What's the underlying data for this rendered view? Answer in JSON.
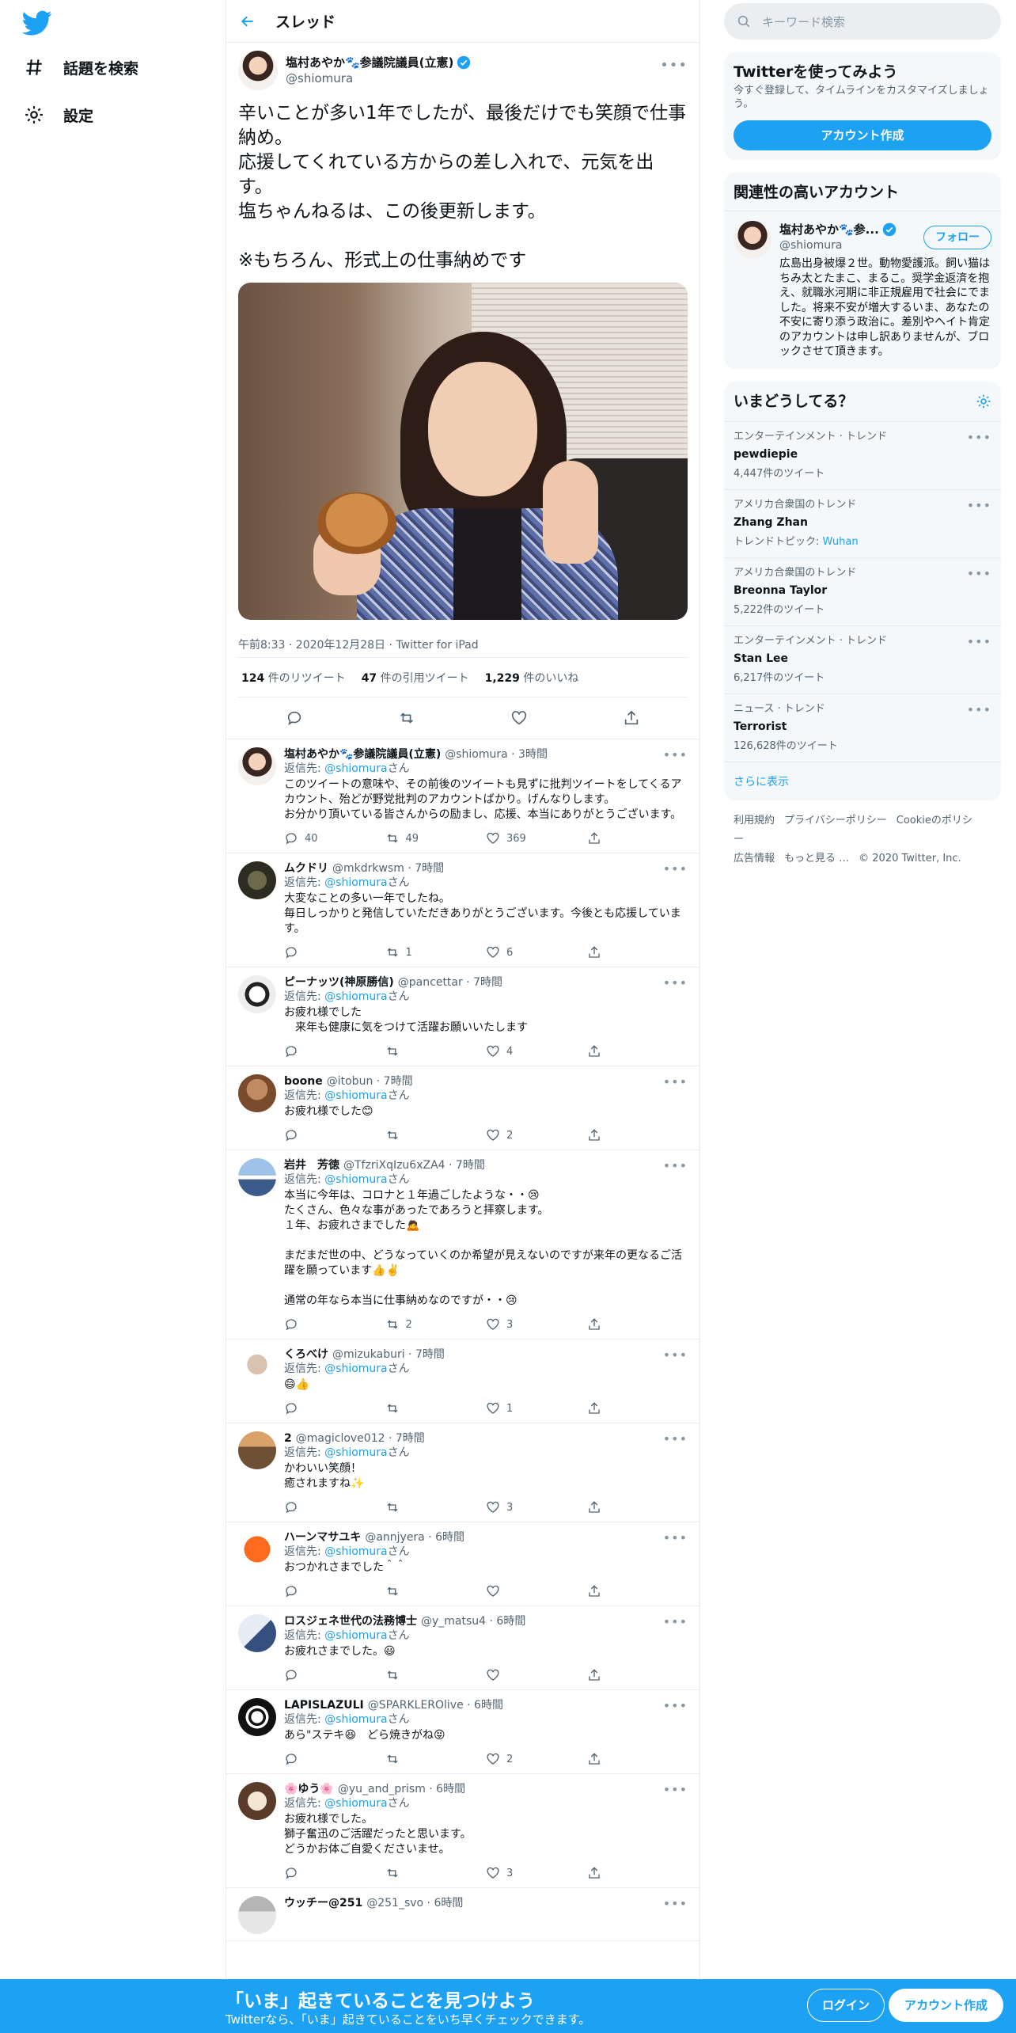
{
  "nav": {
    "explore": "話題を検索",
    "settings": "設定"
  },
  "header": {
    "title": "スレッド"
  },
  "main_tweet": {
    "name": "塩村あやか🐾参議院議員(立憲)",
    "handle": "@shiomura",
    "text": "辛いことが多い1年でしたが、最後だけでも笑顔で仕事納め。\n応援してくれている方からの差し入れで、元気を出す。\n塩ちゃんねるは、この後更新します。\n\n※もちろん、形式上の仕事納めです",
    "meta": "午前8:33 · 2020年12月28日 · Twitter for iPad",
    "retweets_num": "124",
    "retweets_label": "件のリツイート",
    "quotes_num": "47",
    "quotes_label": "件の引用ツイート",
    "likes_num": "1,229",
    "likes_label": "件のいいね"
  },
  "replies": [
    {
      "name": "塩村あやか🐾参議院議員(立憲)",
      "handle": "@shiomura · 3時間",
      "reply_to_prefix": "返信先: ",
      "reply_to": "@shiomura",
      "reply_to_suffix": "さん",
      "text": "このツイートの意味や、その前後のツイートも見ずに批判ツイートをしてくるアカウント、殆どが野党批判のアカウントばかり。げんなりします。\nお分かり頂いている皆さんからの励まし、応援、本当にありがとうございます。",
      "replies": "40",
      "retweets": "49",
      "likes": "369"
    },
    {
      "name": "ムクドリ",
      "handle": "@mkdrkwsm · 7時間",
      "reply_to_prefix": "返信先: ",
      "reply_to": "@shiomura",
      "reply_to_suffix": "さん",
      "text": "大変なことの多い一年でしたね。\n毎日しっかりと発信していただきありがとうございます。今後とも応援しています。",
      "replies": "",
      "retweets": "1",
      "likes": "6"
    },
    {
      "name": "ピーナッツ(神原勝信)",
      "handle": "@pancettar · 7時間",
      "reply_to_prefix": "返信先: ",
      "reply_to": "@shiomura",
      "reply_to_suffix": "さん",
      "text": "お疲れ様でした\n　来年も健康に気をつけて活躍お願いいたします",
      "replies": "",
      "retweets": "",
      "likes": "4"
    },
    {
      "name": "boone",
      "handle": "@itobun · 7時間",
      "reply_to_prefix": "返信先: ",
      "reply_to": "@shiomura",
      "reply_to_suffix": "さん",
      "text": "お疲れ様でした😊",
      "replies": "",
      "retweets": "",
      "likes": "2"
    },
    {
      "name": "岩井　芳徳",
      "handle": "@TfzriXqIzu6xZA4 · 7時間",
      "reply_to_prefix": "返信先: ",
      "reply_to": "@shiomura",
      "reply_to_suffix": "さん",
      "text": "本当に今年は、コロナと１年過ごしたような・・😢\nたくさん、色々な事があったであろうと拝察します。\n１年、お疲れさまでした🙇\n\nまだまだ世の中、どうなっていくのか希望が見えないのですが来年の更なるご活躍を願っています👍✌️\n\n通常の年なら本当に仕事納めなのですが・・😢",
      "replies": "",
      "retweets": "2",
      "likes": "3"
    },
    {
      "name": "くろべけ",
      "handle": "@mizukaburi · 7時間",
      "reply_to_prefix": "返信先: ",
      "reply_to": "@shiomura",
      "reply_to_suffix": "さん",
      "text": "😄👍",
      "replies": "",
      "retweets": "",
      "likes": "1"
    },
    {
      "name": "2",
      "handle": "@magiclove012 · 7時間",
      "reply_to_prefix": "返信先: ",
      "reply_to": "@shiomura",
      "reply_to_suffix": "さん",
      "text": "かわいい笑顔！\n癒されますね✨",
      "replies": "",
      "retweets": "",
      "likes": "3"
    },
    {
      "name": "ハーンマサユキ",
      "handle": "@annjyera · 6時間",
      "reply_to_prefix": "返信先: ",
      "reply_to": "@shiomura",
      "reply_to_suffix": "さん",
      "text": "おつかれさまでした＾＾",
      "replies": "",
      "retweets": "",
      "likes": ""
    },
    {
      "name": "ロスジェネ世代の法務博士",
      "handle": "@y_matsu4 · 6時間",
      "reply_to_prefix": "返信先: ",
      "reply_to": "@shiomura",
      "reply_to_suffix": "さん",
      "text": "お疲れさまでした。😃",
      "replies": "",
      "retweets": "",
      "likes": ""
    },
    {
      "name": "LAPISLAZULI",
      "handle": "@SPARKLEROlive · 6時間",
      "reply_to_prefix": "返信先: ",
      "reply_to": "@shiomura",
      "reply_to_suffix": "さん",
      "text": "あら\"ステキ😆　どら焼きがね😝",
      "replies": "",
      "retweets": "",
      "likes": "2"
    },
    {
      "name": "🌸ゆう🌸",
      "handle": "@yu_and_prism · 6時間",
      "reply_to_prefix": "返信先: ",
      "reply_to": "@shiomura",
      "reply_to_suffix": "さん",
      "text": "お疲れ様でした。\n獅子奮迅のご活躍だったと思います。\nどうかお体ご自愛くださいませ。",
      "replies": "",
      "retweets": "",
      "likes": "3"
    },
    {
      "name": "ウッチー@251",
      "handle": "@251_svo · 6時間",
      "reply_to_prefix": "",
      "reply_to": "",
      "reply_to_suffix": "",
      "text": "",
      "replies": "",
      "retweets": "",
      "likes": ""
    }
  ],
  "sidebar": {
    "search_placeholder": "キーワード検索",
    "signup_box": {
      "title": "Twitterを使ってみよう",
      "sub": "今すぐ登録して、タイムラインをカスタマイズしましょう。",
      "button": "アカウント作成"
    },
    "related": {
      "title": "関連性の高いアカウント",
      "name": "塩村あやか🐾参...",
      "handle": "@shiomura",
      "follow": "フォロー",
      "desc": "広島出身被爆２世。動物愛護派。飼い猫はちみ太とたまこ、まるこ。奨学金返済を抱え、就職氷河期に非正規雇用で社会にでました。将来不安が増大するいま、あなたの不安に寄り添う政治に。差別やヘイト肯定のアカウントは申し訳ありませんが、ブロックさせて頂きます。"
    },
    "trends": {
      "title": "いまどうしてる？",
      "items": [
        {
          "cat": "エンターテインメント · トレンド",
          "name": "pewdiepie",
          "count": "4,447件のツイート",
          "topic": ""
        },
        {
          "cat": "アメリカ合衆国のトレンド",
          "name": "Zhang Zhan",
          "count": "トレンドトピック: ",
          "topic": "Wuhan"
        },
        {
          "cat": "アメリカ合衆国のトレンド",
          "name": "Breonna Taylor",
          "count": "5,222件のツイート",
          "topic": ""
        },
        {
          "cat": "エンターテインメント · トレンド",
          "name": "Stan Lee",
          "count": "6,217件のツイート",
          "topic": ""
        },
        {
          "cat": "ニュース · トレンド",
          "name": "Terrorist",
          "count": "126,628件のツイート",
          "topic": ""
        }
      ],
      "more": "さらに表示"
    },
    "footer": {
      "terms": "利用規約",
      "privacy": "プライバシーポリシー",
      "cookie": "Cookieのポリシー",
      "ads": "広告情報",
      "more": "もっと見る …",
      "copyright": "© 2020 Twitter, Inc."
    }
  },
  "bottom_bar": {
    "title": "「いま」起きていることを見つけよう",
    "sub": "Twitterなら、「いま」起きていることをいち早くチェックできます。",
    "login": "ログイン",
    "signup": "アカウント作成"
  },
  "colors": {
    "accent": "#1da1f2",
    "border": "#e6ecf0",
    "muted": "#536471"
  }
}
